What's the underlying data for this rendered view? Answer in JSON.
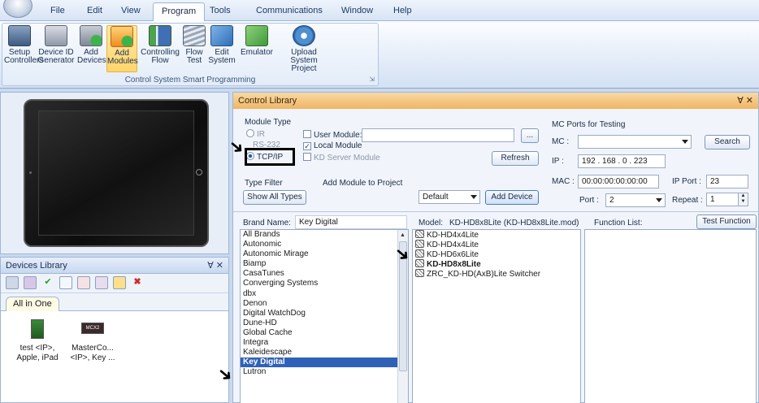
{
  "menu": [
    "File",
    "Edit",
    "View",
    "Program",
    "Tools",
    "Communications",
    "Window",
    "Help"
  ],
  "ribbon": {
    "buttons": [
      {
        "l1": "Setup",
        "l2": "Controllers"
      },
      {
        "l1": "Device ID",
        "l2": "Generator"
      },
      {
        "l1": "Add",
        "l2": "Devices"
      },
      {
        "l1": "Add",
        "l2": "Modules"
      },
      {
        "l1": "Controlling",
        "l2": "Flow"
      },
      {
        "l1": "Flow",
        "l2": "Test"
      },
      {
        "l1": "Edit",
        "l2": "System"
      },
      {
        "l1": "Emulator",
        "l2": ""
      },
      {
        "l1": "Upload System",
        "l2": "Project"
      }
    ],
    "group_label": "Control System Smart Programming"
  },
  "devices_library": {
    "title": "Devices Library",
    "tab": "All in One",
    "items": [
      {
        "l1": "test <IP>,",
        "l2": "Apple, iPad"
      },
      {
        "l1": "MasterCo...",
        "l2": "<IP>, Key ..."
      }
    ],
    "master_badge": "MCX2"
  },
  "control_library": {
    "title": "Control Library",
    "module_type_label": "Module Type",
    "radio_ir": "IR",
    "radio_rs232": "RS-232",
    "radio_tcpip": "TCP/IP",
    "user_module_label": "User Module:",
    "local_module_label": "Local Module",
    "kd_server_label": "KD Server Module",
    "browse_label": "...",
    "refresh_label": "Refresh",
    "type_filter_label": "Type Filter",
    "show_all_types_label": "Show All Types",
    "add_module_label": "Add Module to Project",
    "default_value": "Default",
    "add_device_label": "Add Device",
    "mc_ports_label": "MC Ports for Testing",
    "mc_label": "MC :",
    "mc_value": "",
    "search_label": "Search",
    "ip_label": "IP :",
    "ip_value": "192 . 168 .  0  . 223",
    "mac_label": "MAC :",
    "mac_value": "00:00:00:00:00:00",
    "ip_port_label": "IP Port :",
    "ip_port_value": "23",
    "port_label": "Port :",
    "port_value": "2",
    "repeat_label": "Repeat :",
    "repeat_value": "1",
    "brand_name_label": "Brand Name:",
    "brand_name_value": "Key Digital",
    "model_label": "Model:",
    "model_value": "KD-HD8x8Lite (KD-HD8x8Lite.mod)",
    "function_list_label": "Function List:",
    "test_function_label": "Test Function",
    "brands": [
      "All Brands",
      "Autonomic",
      "Autonomic Mirage",
      "Biamp",
      "CasaTunes",
      "Converging Systems",
      "dbx",
      "Denon",
      "Digital WatchDog",
      "Dune-HD",
      "Global Cache",
      "Integra",
      "Kaleidescape",
      "Key Digital",
      "Lutron"
    ],
    "models": [
      "KD-HD4x4Lite",
      "KD-HD4x4Lite",
      "KD-HD6x6Lite",
      "KD-HD8x8Lite",
      "ZRC_KD-HD(AxB)Lite Switcher"
    ]
  }
}
